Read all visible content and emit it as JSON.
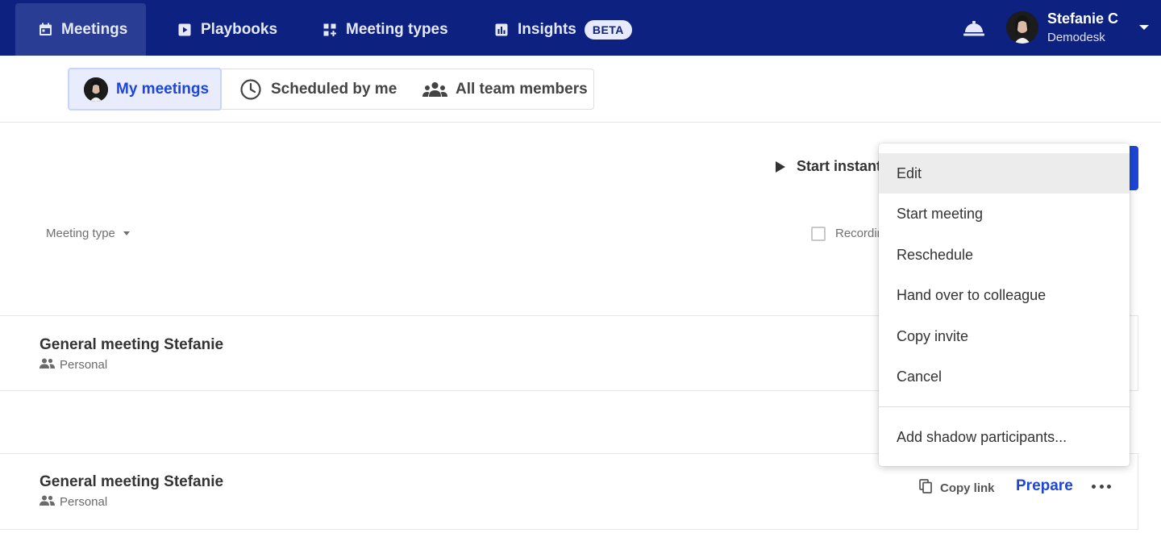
{
  "nav": {
    "tabs": [
      {
        "label": "Meetings",
        "icon": "calendar-icon",
        "active": true
      },
      {
        "label": "Playbooks",
        "icon": "play-square-icon",
        "active": false
      },
      {
        "label": "Meeting types",
        "icon": "grid-plus-icon",
        "active": false
      },
      {
        "label": "Insights",
        "icon": "bar-chart-icon",
        "active": false,
        "badge": "BETA"
      }
    ],
    "bell_icon": "service-bell-icon",
    "user": {
      "name": "Stefanie C",
      "org": "Demodesk"
    }
  },
  "subtabs": [
    {
      "label": "My meetings",
      "icon": "avatar",
      "active": true
    },
    {
      "label": "Scheduled by me",
      "icon": "clock-icon",
      "active": false
    },
    {
      "label": "All team members",
      "icon": "group-icon",
      "active": false
    }
  ],
  "toolbar": {
    "start_instant": "Start instant",
    "filter_meeting_type": "Meeting type",
    "recording_label": "Recording"
  },
  "rows": [
    {
      "title": "General meeting Stefanie",
      "type": "Personal"
    },
    {
      "title": "General meeting Stefanie",
      "type": "Personal",
      "copy_link": "Copy link",
      "prepare": "Prepare"
    }
  ],
  "menu": {
    "items": [
      "Edit",
      "Start meeting",
      "Reschedule",
      "Hand over to colleague",
      "Copy invite",
      "Cancel"
    ],
    "footer_item": "Add shadow participants..."
  },
  "colors": {
    "nav_bg": "#0d2180",
    "accent": "#1d46d8",
    "active_subtab_bg": "#e8ecfd"
  }
}
